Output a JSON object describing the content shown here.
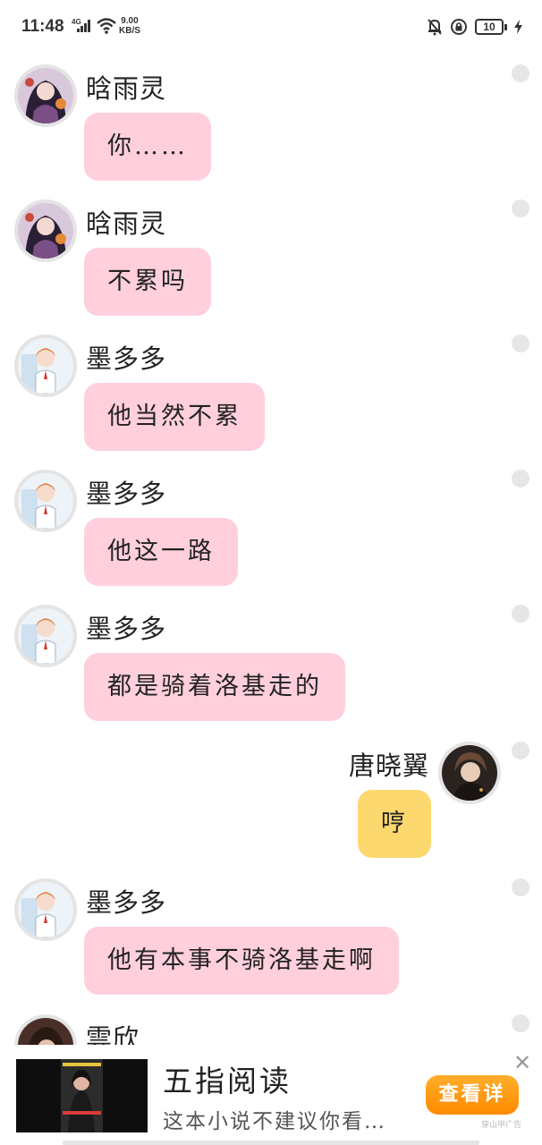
{
  "status_bar": {
    "time": "11:48",
    "network": "4G",
    "speed_value": "9.00",
    "speed_unit": "KB/S",
    "battery": "10",
    "icons": [
      "signal-icon",
      "wifi-icon",
      "mute-bell-icon",
      "rotation-lock-icon",
      "battery-icon",
      "charging-icon"
    ]
  },
  "messages": [
    {
      "sender": "晗雨灵",
      "text": "你……",
      "side": "left",
      "avatar": "girl-avatar"
    },
    {
      "sender": "晗雨灵",
      "text": "不累吗",
      "side": "left",
      "avatar": "girl-avatar"
    },
    {
      "sender": "墨多多",
      "text": "他当然不累",
      "side": "left",
      "avatar": "boy-avatar"
    },
    {
      "sender": "墨多多",
      "text": "他这一路",
      "side": "left",
      "avatar": "boy-avatar"
    },
    {
      "sender": "墨多多",
      "text": "都是骑着洛基走的",
      "side": "left",
      "avatar": "boy-avatar"
    },
    {
      "sender": "唐晓翼",
      "text": "哼",
      "side": "right",
      "avatar": "dark-avatar"
    },
    {
      "sender": "墨多多",
      "text": "他有本事不骑洛基走啊",
      "side": "left",
      "avatar": "boy-avatar"
    },
    {
      "sender": "雲欣",
      "text": "",
      "side": "left",
      "avatar": "partial-avatar"
    }
  ],
  "ad": {
    "title": "五指阅读",
    "description": "这本小说不建议你看…",
    "button_label": "查看详",
    "close_glyph": "✕",
    "badge": "穿山甲广告"
  },
  "colors": {
    "left_bubble": "#ffcfdc",
    "right_bubble": "#fdd86e",
    "ad_button": "#ff9a16"
  }
}
